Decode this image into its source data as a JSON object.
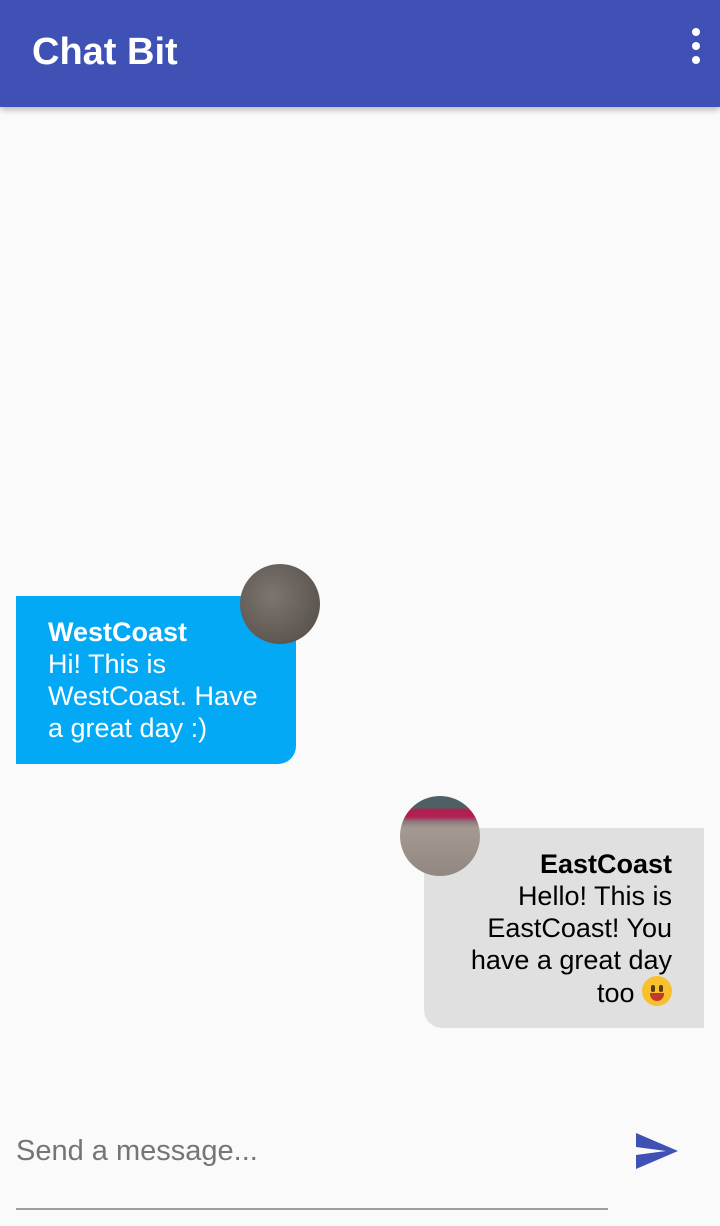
{
  "app_bar": {
    "title": "Chat Bit",
    "color": "#3f51b5",
    "menu_icon": "more-vert-icon"
  },
  "messages": [
    {
      "sender": "WestCoast",
      "text": "Hi! This is WestCoast. Have a great day :)",
      "side": "left",
      "bubble_color": "#03a9f4"
    },
    {
      "sender": "EastCoast",
      "text": "Hello! This is EastCoast! You have a great day too",
      "emoji": "smiling-face-emoji",
      "side": "right",
      "bubble_color": "#e0e0e0"
    }
  ],
  "composer": {
    "placeholder": "Send a message...",
    "value": "",
    "send_icon": "send-icon",
    "send_color": "#3f51b5"
  }
}
